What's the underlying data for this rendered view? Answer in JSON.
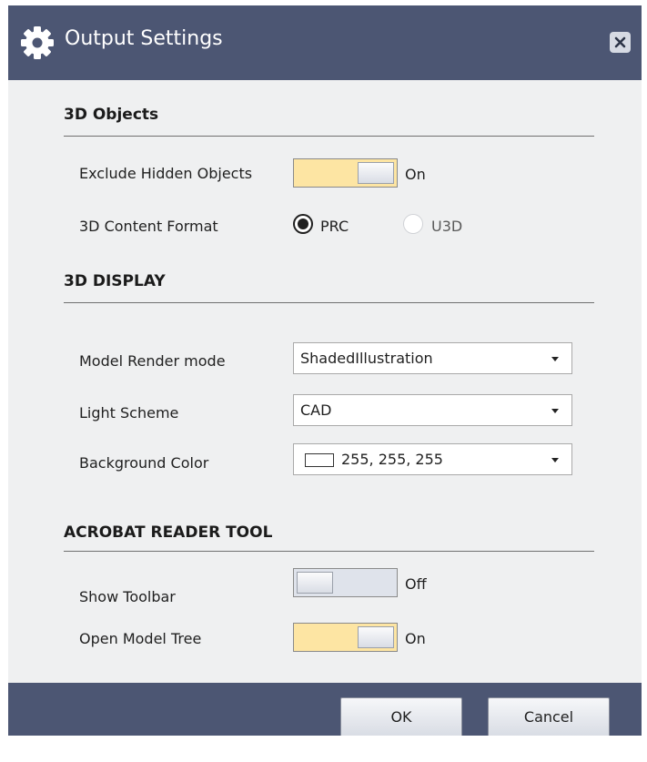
{
  "dialog": {
    "title": "Output Settings",
    "colors": {
      "titlebar": "#4c5673",
      "content_bg": "#eff0f1",
      "toggle_on": "#fde5a3",
      "toggle_off": "#dfe3eb"
    }
  },
  "objects_section": {
    "title": "3D Objects",
    "exclude_hidden": {
      "label": "Exclude Hidden Objects",
      "state": "On"
    },
    "content_format": {
      "label": "3D Content Format",
      "options": [
        "PRC",
        "U3D"
      ],
      "selected": "PRC"
    }
  },
  "display_section": {
    "title": "3D DISPLAY",
    "render_mode": {
      "label": "Model Render mode",
      "value": "ShadedIllustration"
    },
    "light_scheme": {
      "label": "Light Scheme",
      "value": "CAD"
    },
    "background_color": {
      "label": "Background Color",
      "value": "255, 255, 255",
      "swatch": "#ffffff"
    }
  },
  "reader_section": {
    "title": "ACROBAT READER TOOL",
    "show_toolbar": {
      "label": "Show Toolbar",
      "state": "Off"
    },
    "open_model_tree": {
      "label": "Open Model Tree",
      "state": "On"
    }
  },
  "footer": {
    "ok_label": "OK",
    "cancel_label": "Cancel"
  },
  "icons": {
    "title": "gear-icon",
    "close": "close-icon",
    "dropdown": "caret-down-icon"
  }
}
